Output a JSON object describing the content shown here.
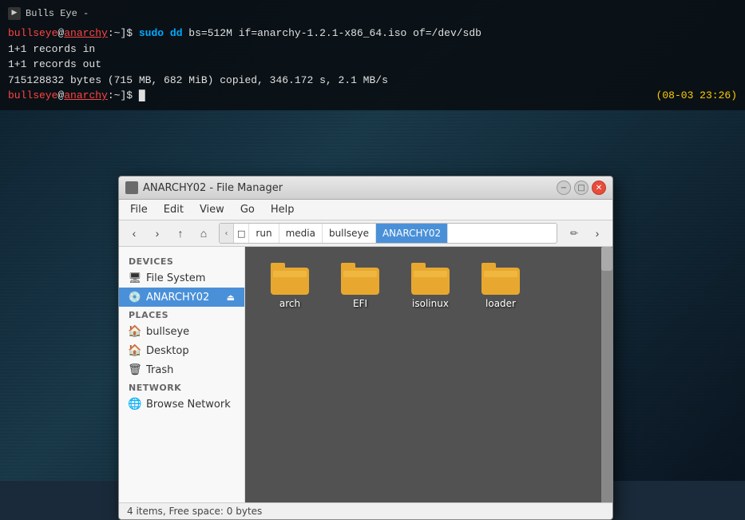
{
  "terminal": {
    "title": "Bulls Eye -",
    "line1": "[bullseye@anarchy:~]$ sudo dd bs=512M if=anarchy-1.2.1-x86_64.iso of=/dev/sdb",
    "line2": "1+1 records in",
    "line3": "1+1 records out",
    "line4": "715128832 bytes (715 MB, 682 MiB) copied, 346.172 s, 2.1 MB/s",
    "line5_prompt": "[bullseye@anarchy:~]$ ",
    "timestamp": "(08-03 23:26)",
    "user": "bullseye",
    "host": "anarchy"
  },
  "filemanager": {
    "title": "ANARCHY02 - File Manager",
    "menu": {
      "file": "File",
      "edit": "Edit",
      "view": "View",
      "go": "Go",
      "help": "Help"
    },
    "breadcrumb": {
      "items": [
        "run",
        "media",
        "bullseye",
        "ANARCHY02"
      ],
      "active": "ANARCHY02"
    },
    "sidebar": {
      "devices_header": "DEVICES",
      "places_header": "PLACES",
      "network_header": "NETWORK",
      "devices": [
        {
          "label": "File System",
          "icon": "💾"
        },
        {
          "label": "ANARCHY02",
          "icon": "💿",
          "active": true
        }
      ],
      "places": [
        {
          "label": "bullseye",
          "icon": "🏠"
        },
        {
          "label": "Desktop",
          "icon": "🏠"
        },
        {
          "label": "Trash",
          "icon": "🗑"
        }
      ],
      "network": [
        {
          "label": "Browse Network",
          "icon": "🌐"
        }
      ]
    },
    "folders": [
      {
        "label": "arch"
      },
      {
        "label": "EFI"
      },
      {
        "label": "isolinux"
      },
      {
        "label": "loader"
      }
    ],
    "statusbar": "4 items, Free space: 0 bytes"
  }
}
